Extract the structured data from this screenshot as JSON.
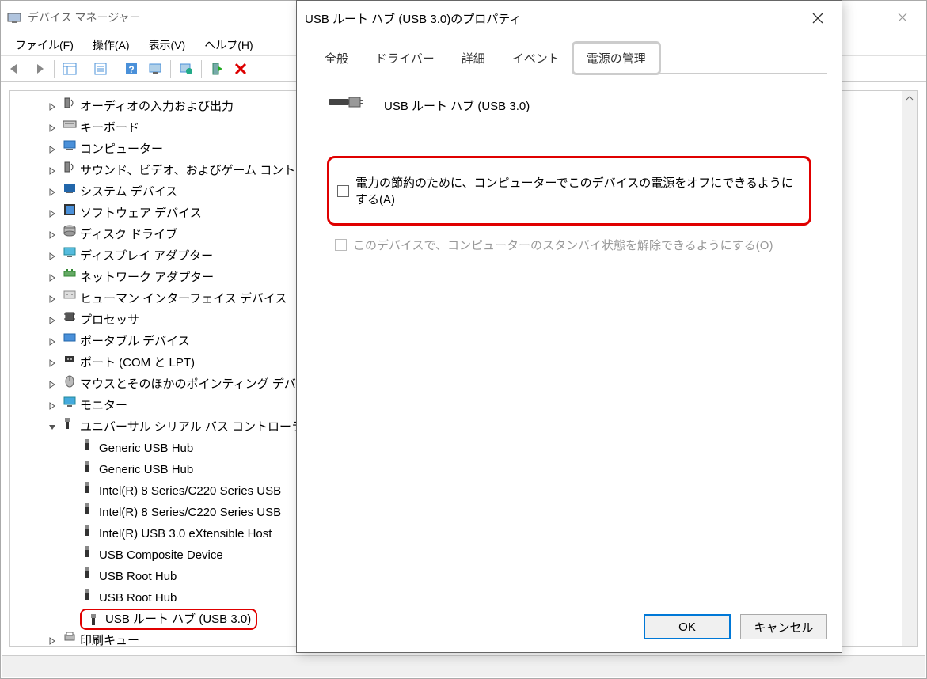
{
  "window": {
    "title": "デバイス マネージャー",
    "close_icon": "close"
  },
  "menu": {
    "file": "ファイル(F)",
    "action": "操作(A)",
    "view": "表示(V)",
    "help": "ヘルプ(H)"
  },
  "toolbar": {
    "back": "back",
    "forward": "forward",
    "list": "list",
    "prop": "prop",
    "help": "help",
    "scan": "scan",
    "monitor": "monitor",
    "enable": "enable",
    "uninstall": "uninstall"
  },
  "tree": {
    "items": [
      {
        "indent": 1,
        "toggle": ">",
        "icon": "speaker",
        "label": "オーディオの入力および出力"
      },
      {
        "indent": 1,
        "toggle": ">",
        "icon": "keyboard",
        "label": "キーボード"
      },
      {
        "indent": 1,
        "toggle": ">",
        "icon": "computer",
        "label": "コンピューター"
      },
      {
        "indent": 1,
        "toggle": ">",
        "icon": "speaker",
        "label": "サウンド、ビデオ、およびゲーム コントローラー"
      },
      {
        "indent": 1,
        "toggle": ">",
        "icon": "system",
        "label": "システム デバイス"
      },
      {
        "indent": 1,
        "toggle": ">",
        "icon": "software",
        "label": "ソフトウェア デバイス"
      },
      {
        "indent": 1,
        "toggle": ">",
        "icon": "disk",
        "label": "ディスク ドライブ"
      },
      {
        "indent": 1,
        "toggle": ">",
        "icon": "display",
        "label": "ディスプレイ アダプター"
      },
      {
        "indent": 1,
        "toggle": ">",
        "icon": "network",
        "label": "ネットワーク アダプター"
      },
      {
        "indent": 1,
        "toggle": ">",
        "icon": "hid",
        "label": "ヒューマン インターフェイス デバイス"
      },
      {
        "indent": 1,
        "toggle": ">",
        "icon": "cpu",
        "label": "プロセッサ"
      },
      {
        "indent": 1,
        "toggle": ">",
        "icon": "portable",
        "label": "ポータブル デバイス"
      },
      {
        "indent": 1,
        "toggle": ">",
        "icon": "port",
        "label": "ポート (COM と LPT)"
      },
      {
        "indent": 1,
        "toggle": ">",
        "icon": "mouse",
        "label": "マウスとそのほかのポインティング デバイス"
      },
      {
        "indent": 1,
        "toggle": ">",
        "icon": "monitor",
        "label": "モニター"
      },
      {
        "indent": 1,
        "toggle": "v",
        "icon": "usb",
        "label": "ユニバーサル シリアル バス コントローラー"
      },
      {
        "indent": 2,
        "toggle": "",
        "icon": "usb-item",
        "label": "Generic USB Hub"
      },
      {
        "indent": 2,
        "toggle": "",
        "icon": "usb-item",
        "label": "Generic USB Hub"
      },
      {
        "indent": 2,
        "toggle": "",
        "icon": "usb-item",
        "label": "Intel(R) 8 Series/C220 Series USB"
      },
      {
        "indent": 2,
        "toggle": "",
        "icon": "usb-item",
        "label": "Intel(R) 8 Series/C220 Series USB"
      },
      {
        "indent": 2,
        "toggle": "",
        "icon": "usb-item",
        "label": "Intel(R) USB 3.0 eXtensible Host"
      },
      {
        "indent": 2,
        "toggle": "",
        "icon": "usb-item",
        "label": "USB Composite Device"
      },
      {
        "indent": 2,
        "toggle": "",
        "icon": "usb-item",
        "label": "USB Root Hub"
      },
      {
        "indent": 2,
        "toggle": "",
        "icon": "usb-item",
        "label": "USB Root Hub"
      },
      {
        "indent": 2,
        "toggle": "",
        "icon": "usb-item",
        "label": "USB ルート ハブ (USB 3.0)",
        "highlight": true
      },
      {
        "indent": 1,
        "toggle": ">",
        "icon": "printer",
        "label": "印刷キュー"
      }
    ]
  },
  "dialog": {
    "title": "USB ルート ハブ (USB 3.0)のプロパティ",
    "tabs": {
      "general": "全般",
      "driver": "ドライバー",
      "details": "詳細",
      "events": "イベント",
      "power": "電源の管理"
    },
    "device_name": "USB ルート ハブ (USB 3.0)",
    "option1": "電力の節約のために、コンピューターでこのデバイスの電源をオフにできるようにする(A)",
    "option2": "このデバイスで、コンピューターのスタンバイ状態を解除できるようにする(O)",
    "ok": "OK",
    "cancel": "キャンセル"
  }
}
